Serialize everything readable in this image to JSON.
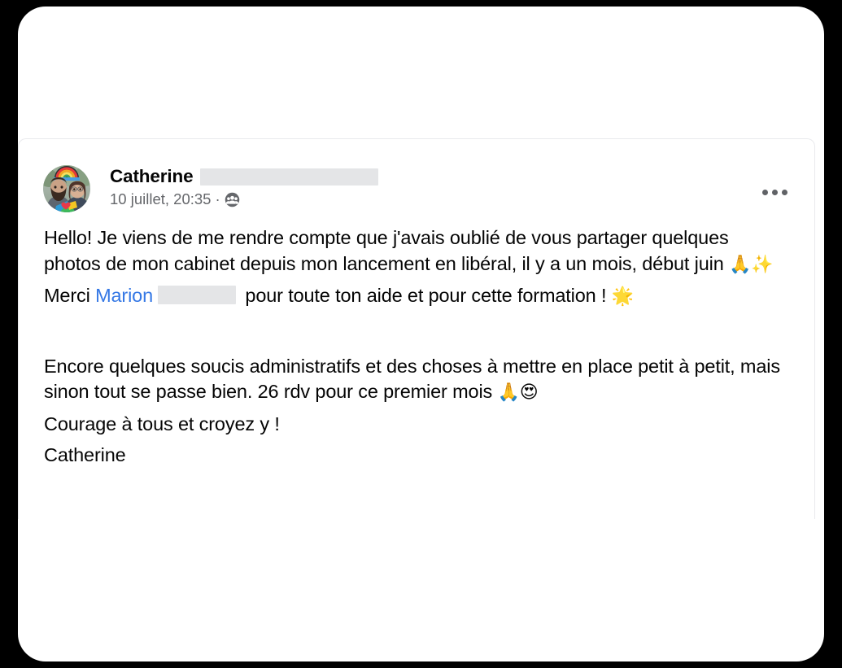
{
  "theme": {
    "page_background": "#000000",
    "card_background": "#ffffff",
    "card_border": "#e9eaed",
    "text_primary": "#050505",
    "text_secondary": "#65676b",
    "link_color": "#3578e5",
    "redaction_color": "#e4e5e7",
    "more_dot_color": "#606266"
  },
  "post": {
    "author": {
      "name": "Catherine",
      "name_redacted": true,
      "avatar_alt": "photo de profil"
    },
    "meta": {
      "timestamp": "10 juillet, 20:35",
      "separator": "·",
      "audience_icon": "group-audience-icon"
    },
    "more_button": {
      "label": "",
      "icon": "ellipsis-horizontal-icon"
    },
    "body": {
      "paragraph_1": {
        "text_before_emoji": "Hello! Je viens de me rendre compte que j'avais oublié de vous partager quelques photos de mon cabinet depuis mon lancement en libéral, il y a un mois, début juin ",
        "emoji": "🙏✨"
      },
      "paragraph_2": {
        "prefix": "Merci ",
        "mention": "Marion",
        "mention_redacted": true,
        "suffix": " pour toute ton aide et pour cette formation ! ",
        "emoji": "🌟"
      },
      "paragraph_3": {
        "text": "Encore quelques soucis administratifs et des choses à mettre en place petit à petit, mais sinon tout se passe bien. 26 rdv pour ce premier mois ",
        "emoji": "🙏😍"
      },
      "paragraph_4": {
        "text": "Courage à tous et croyez y !"
      },
      "paragraph_5": {
        "text": "Catherine"
      }
    }
  }
}
